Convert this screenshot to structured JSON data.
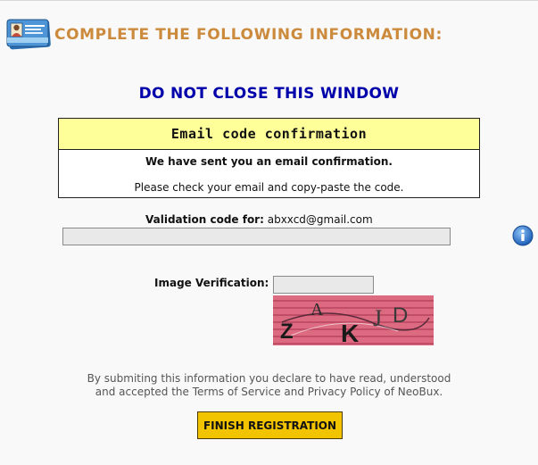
{
  "header": {
    "icon": "id-card-icon",
    "title": "COMPLETE THE FOLLOWING INFORMATION:"
  },
  "warning": "DO NOT CLOSE THIS WINDOW",
  "email_box": {
    "title": "Email code confirmation",
    "line1": "We have sent you an email confirmation.",
    "line2": "Please check your email and copy-paste the code."
  },
  "validation": {
    "label": "Validation code for:",
    "email": "abxxcd@gmail.com",
    "value": "",
    "info_icon": "info-icon"
  },
  "image_verification": {
    "label": "Image Verification:",
    "value": "",
    "captcha_text": "ZAKJD"
  },
  "disclaimer": {
    "line1": "By submiting this information you declare to have read, understood",
    "line2": "and accepted the Terms of Service and Privacy Policy of NeoBux."
  },
  "finish_button": "FINISH REGISTRATION",
  "colors": {
    "title": "#cc8a3c",
    "warning": "#0000aa",
    "box_header": "#ffff99",
    "button": "#f2c400"
  }
}
